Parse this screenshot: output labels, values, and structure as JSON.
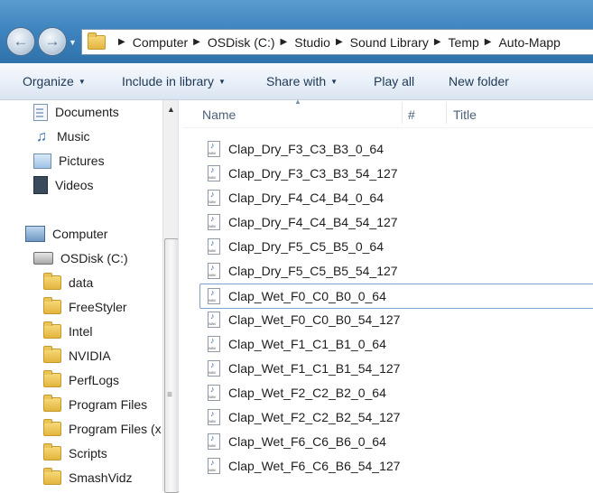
{
  "address": {
    "breadcrumbs": [
      "Computer",
      "OSDisk (C:)",
      "Studio",
      "Sound Library",
      "Temp",
      "Auto-Mapp"
    ]
  },
  "toolbar": {
    "organize": "Organize",
    "include_in_library": "Include in library",
    "share_with": "Share with",
    "play_all": "Play all",
    "new_folder": "New folder"
  },
  "nav": {
    "libraries": [
      {
        "label": "Documents",
        "icon": "documents-icon"
      },
      {
        "label": "Music",
        "icon": "music-icon"
      },
      {
        "label": "Pictures",
        "icon": "pictures-icon"
      },
      {
        "label": "Videos",
        "icon": "videos-icon"
      }
    ],
    "computer": "Computer",
    "drive": "OSDisk (C:)",
    "folders": [
      "data",
      "FreeStyler",
      "Intel",
      "NVIDIA",
      "PerfLogs",
      "Program Files",
      "Program Files (x",
      "Scripts",
      "SmashVidz"
    ]
  },
  "columns": {
    "name": "Name",
    "number": "#",
    "title": "Title"
  },
  "files": [
    "Clap_Dry_F3_C3_B3_0_64",
    "Clap_Dry_F3_C3_B3_54_127",
    "Clap_Dry_F4_C4_B4_0_64",
    "Clap_Dry_F4_C4_B4_54_127",
    "Clap_Dry_F5_C5_B5_0_64",
    "Clap_Dry_F5_C5_B5_54_127",
    "Clap_Wet_F0_C0_B0_0_64",
    "Clap_Wet_F0_C0_B0_54_127",
    "Clap_Wet_F1_C1_B1_0_64",
    "Clap_Wet_F1_C1_B1_54_127",
    "Clap_Wet_F2_C2_B2_0_64",
    "Clap_Wet_F2_C2_B2_54_127",
    "Clap_Wet_F6_C6_B6_0_64",
    "Clap_Wet_F6_C6_B6_54_127"
  ],
  "selected_file_index": 6,
  "colors": {
    "address_bar_blue": "#3f85bf",
    "selection_border": "#7da2ce",
    "command_text": "#1e3956"
  }
}
